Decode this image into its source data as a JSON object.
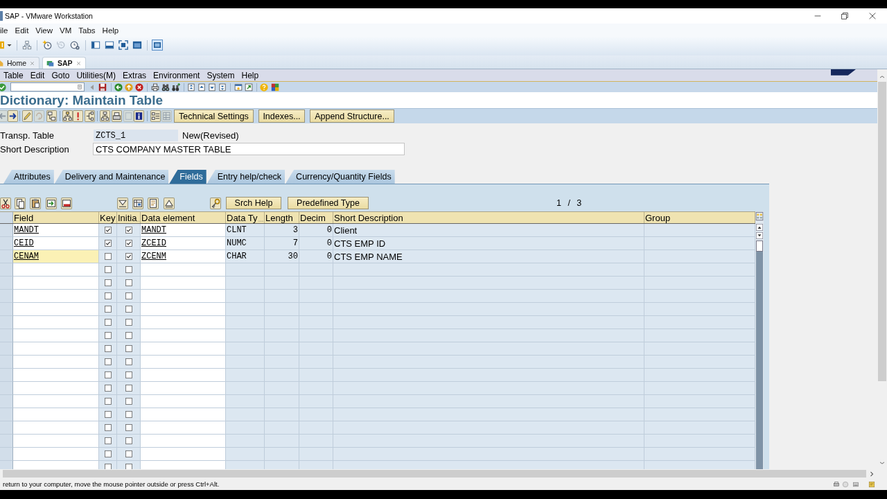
{
  "vm_window": {
    "title": "SAP - VMware Workstation",
    "menu": [
      "ile",
      "Edit",
      "View",
      "VM",
      "Tabs",
      "Help"
    ],
    "toolbar": [
      {
        "disabled": false,
        "pressed": false
      },
      {
        "disabled": false,
        "pressed": false
      },
      {
        "disabled": false,
        "pressed": false
      },
      {
        "disabled": true,
        "pressed": false
      },
      {
        "disabled": false,
        "pressed": false
      },
      {
        "disabled": false,
        "pressed": false
      },
      {
        "disabled": false,
        "pressed": false
      },
      {
        "disabled": false,
        "pressed": false
      },
      {
        "disabled": false,
        "pressed": false
      },
      {
        "disabled": false,
        "pressed": true
      }
    ],
    "tabs": [
      {
        "label": "Home",
        "selected": false
      },
      {
        "label": "SAP",
        "selected": true
      }
    ]
  },
  "sap": {
    "menu": [
      "Table",
      "Edit",
      "Goto",
      "Utilities(M)",
      "Extras",
      "Environment",
      "System",
      "Help"
    ],
    "title": "Dictionary: Maintain Table",
    "app_toolbar": {
      "icons": [
        {
          "disabled": true
        },
        {
          "disabled": false
        },
        {
          "disabled": false
        },
        {
          "disabled": true
        },
        {
          "disabled": false
        },
        {
          "disabled": false
        },
        {
          "disabled": false
        },
        {
          "disabled": false
        },
        {
          "disabled": false
        },
        {
          "disabled": false
        },
        {
          "disabled": true
        },
        {
          "disabled": false
        },
        {
          "disabled": false
        },
        {
          "disabled": true
        }
      ],
      "buttons": [
        "Technical Settings",
        "Indexes...",
        "Append Structure..."
      ]
    },
    "header_fields": [
      {
        "label": "Transp. Table",
        "value": "ZCTS_1",
        "status": "New(Revised)",
        "kind": "display"
      },
      {
        "label": "Short Description",
        "value": "CTS COMPANY MASTER TABLE",
        "kind": "input"
      }
    ],
    "tabs": [
      {
        "label": "Attributes",
        "selected": false
      },
      {
        "label": "Delivery and Maintenance",
        "selected": false
      },
      {
        "label": "Fields",
        "selected": true
      },
      {
        "label": "Entry help/check",
        "selected": false
      },
      {
        "label": "Currency/Quantity Fields",
        "selected": false
      }
    ],
    "fields_panel": {
      "toolbar_buttons": [
        "Srch Help",
        "Predefined Type"
      ],
      "page": "1 / 3",
      "columns": [
        {
          "label": "Field",
          "truncated": false
        },
        {
          "label": "Key",
          "truncated": false
        },
        {
          "label": "Initia",
          "truncated": true
        },
        {
          "label": "Data element",
          "truncated": false
        },
        {
          "label": "Data Ty",
          "truncated": true
        },
        {
          "label": "Length",
          "truncated": false
        },
        {
          "label": "Decim",
          "truncated": false
        },
        {
          "label": "Short Description",
          "truncated": false
        },
        {
          "label": "Group",
          "truncated": false
        }
      ],
      "rows": [
        {
          "field": "MANDT",
          "key": true,
          "initial": true,
          "data_element": "MANDT",
          "data_type": "CLNT",
          "length": "3",
          "decimals": "0",
          "short_description": "Client",
          "focused": false
        },
        {
          "field": "CEID",
          "key": true,
          "initial": true,
          "data_element": "ZCEID",
          "data_type": "NUMC",
          "length": "7",
          "decimals": "0",
          "short_description": "CTS EMP ID",
          "focused": false
        },
        {
          "field": "CENAM",
          "key": false,
          "initial": true,
          "data_element": "ZCENM",
          "data_type": "CHAR",
          "length": "30",
          "decimals": "0",
          "short_description": "CTS EMP NAME",
          "focused": true
        },
        {
          "key": false,
          "initial": false,
          "focused": false
        },
        {
          "key": false,
          "initial": false,
          "focused": false
        },
        {
          "key": false,
          "initial": false,
          "focused": false
        },
        {
          "key": false,
          "initial": false,
          "focused": false
        },
        {
          "key": false,
          "initial": false,
          "focused": false
        },
        {
          "key": false,
          "initial": false,
          "focused": false
        },
        {
          "key": false,
          "initial": false,
          "focused": false
        },
        {
          "key": false,
          "initial": false,
          "focused": false
        },
        {
          "key": false,
          "initial": false,
          "focused": false
        },
        {
          "key": false,
          "initial": false,
          "focused": false
        },
        {
          "key": false,
          "initial": false,
          "focused": false
        },
        {
          "key": false,
          "initial": false,
          "focused": false
        },
        {
          "key": false,
          "initial": false,
          "focused": false
        },
        {
          "key": false,
          "initial": false,
          "focused": false
        },
        {
          "key": false,
          "initial": false,
          "focused": false
        },
        {
          "key": false,
          "initial": false,
          "focused": false
        }
      ]
    }
  },
  "status_bar": {
    "message": "return to your computer, move the mouse pointer outside or press Ctrl+Alt."
  }
}
